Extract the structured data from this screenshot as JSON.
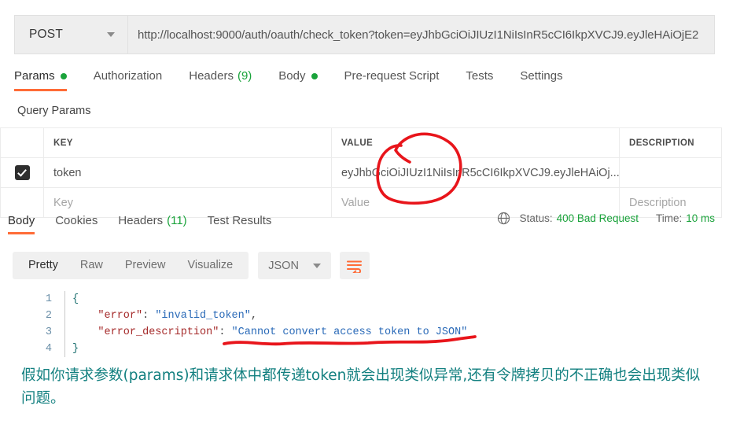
{
  "request": {
    "method": "POST",
    "url": "http://localhost:9000/auth/oauth/check_token?token=eyJhbGciOiJIUzI1NiIsInR5cCI6IkpXVCJ9.eyJleHAiOjE2",
    "tabs": [
      {
        "label": "Params",
        "indicator": "dot",
        "active": true
      },
      {
        "label": "Authorization",
        "indicator": "",
        "active": false
      },
      {
        "label": "Headers",
        "indicator": "(9)",
        "active": false
      },
      {
        "label": "Body",
        "indicator": "dot",
        "active": false
      },
      {
        "label": "Pre-request Script",
        "indicator": "",
        "active": false
      },
      {
        "label": "Tests",
        "indicator": "",
        "active": false
      },
      {
        "label": "Settings",
        "indicator": "",
        "active": false
      }
    ]
  },
  "query_params": {
    "section_title": "Query Params",
    "headers": {
      "key": "KEY",
      "value": "VALUE",
      "description": "DESCRIPTION"
    },
    "rows": [
      {
        "checked": true,
        "key": "token",
        "value": "eyJhbGciOiJIUzI1NiIsInR5cCI6IkpXVCJ9.eyJleHAiOj...",
        "description": ""
      }
    ],
    "placeholder_row": {
      "key": "Key",
      "value": "Value",
      "description": "Description"
    }
  },
  "response": {
    "tabs": [
      {
        "label": "Body",
        "indicator": "",
        "active": true
      },
      {
        "label": "Cookies",
        "indicator": "",
        "active": false
      },
      {
        "label": "Headers",
        "indicator": "(11)",
        "active": false
      },
      {
        "label": "Test Results",
        "indicator": "",
        "active": false
      }
    ],
    "status_label": "Status:",
    "status_value": "400 Bad Request",
    "time_label": "Time:",
    "time_value": "10 ms",
    "toolbar": {
      "views": [
        "Pretty",
        "Raw",
        "Preview",
        "Visualize"
      ],
      "active_view": "Pretty",
      "format": "JSON"
    },
    "body_lines": [
      {
        "no": "1",
        "tokens": [
          {
            "t": "{",
            "c": "tok-brace"
          }
        ]
      },
      {
        "no": "2",
        "tokens": [
          {
            "t": "    \"error\"",
            "c": "tok-key"
          },
          {
            "t": ": ",
            "c": "tok-punct"
          },
          {
            "t": "\"invalid_token\"",
            "c": "tok-str"
          },
          {
            "t": ",",
            "c": "tok-punct"
          }
        ]
      },
      {
        "no": "3",
        "tokens": [
          {
            "t": "    \"error_description\"",
            "c": "tok-key"
          },
          {
            "t": ": ",
            "c": "tok-punct"
          },
          {
            "t": "\"Cannot convert access token to JSON\"",
            "c": "tok-str"
          }
        ]
      },
      {
        "no": "4",
        "tokens": [
          {
            "t": "}",
            "c": "tok-brace"
          }
        ]
      }
    ]
  },
  "annotations": {
    "color": "#e8151b",
    "circle_target": "query-param-token-value",
    "underline_target": "error-description-line"
  },
  "note": {
    "text": "假如你请求参数(params)和请求体中都传递token就会出现类似异常,还有令牌拷贝的不正确也会出现类似问题。",
    "color": "#138080"
  }
}
